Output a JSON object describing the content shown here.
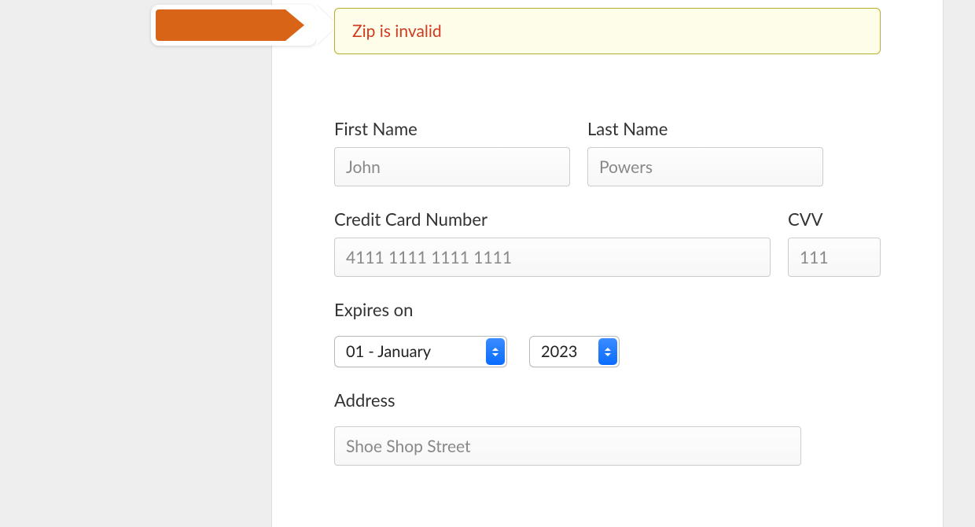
{
  "alert": {
    "message": "Zip is invalid"
  },
  "form": {
    "first_name": {
      "label": "First Name",
      "value": "John"
    },
    "last_name": {
      "label": "Last Name",
      "value": "Powers"
    },
    "card_number": {
      "label": "Credit Card Number",
      "value": "4111 1111 1111 1111"
    },
    "cvv": {
      "label": "CVV",
      "value": "111"
    },
    "expires": {
      "label": "Expires on",
      "month_selected": "01 - January",
      "year_selected": "2023"
    },
    "address": {
      "label": "Address",
      "value": "Shoe Shop Street"
    }
  }
}
